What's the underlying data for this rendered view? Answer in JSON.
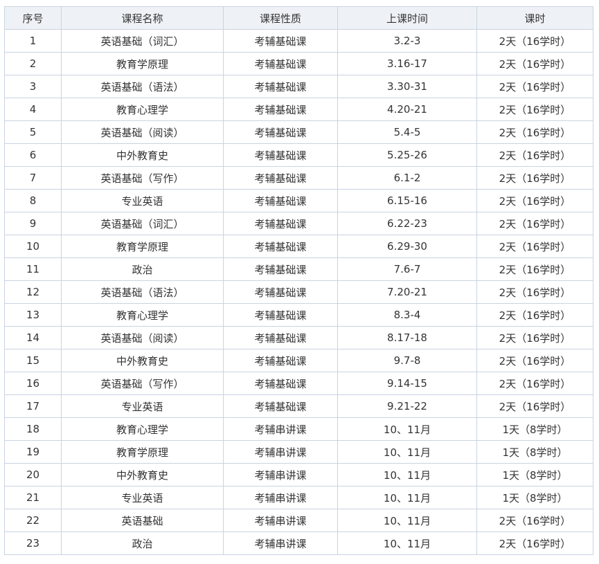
{
  "table": {
    "headers": [
      "序号",
      "课程名称",
      "课程性质",
      "上课时间",
      "课时"
    ],
    "rows": [
      [
        "1",
        "英语基础（词汇）",
        "考辅基础课",
        "3.2-3",
        "2天（16学时）"
      ],
      [
        "2",
        "教育学原理",
        "考辅基础课",
        "3.16-17",
        "2天（16学时）"
      ],
      [
        "3",
        "英语基础（语法）",
        "考辅基础课",
        "3.30-31",
        "2天（16学时）"
      ],
      [
        "4",
        "教育心理学",
        "考辅基础课",
        "4.20-21",
        "2天（16学时）"
      ],
      [
        "5",
        "英语基础（阅读）",
        "考辅基础课",
        "5.4-5",
        "2天（16学时）"
      ],
      [
        "6",
        "中外教育史",
        "考辅基础课",
        "5.25-26",
        "2天（16学时）"
      ],
      [
        "7",
        "英语基础（写作）",
        "考辅基础课",
        "6.1-2",
        "2天（16学时）"
      ],
      [
        "8",
        "专业英语",
        "考辅基础课",
        "6.15-16",
        "2天（16学时）"
      ],
      [
        "9",
        "英语基础（词汇）",
        "考辅基础课",
        "6.22-23",
        "2天（16学时）"
      ],
      [
        "10",
        "教育学原理",
        "考辅基础课",
        "6.29-30",
        "2天（16学时）"
      ],
      [
        "11",
        "政治",
        "考辅基础课",
        "7.6-7",
        "2天（16学时）"
      ],
      [
        "12",
        "英语基础（语法）",
        "考辅基础课",
        "7.20-21",
        "2天（16学时）"
      ],
      [
        "13",
        "教育心理学",
        "考辅基础课",
        "8.3-4",
        "2天（16学时）"
      ],
      [
        "14",
        "英语基础（阅读）",
        "考辅基础课",
        "8.17-18",
        "2天（16学时）"
      ],
      [
        "15",
        "中外教育史",
        "考辅基础课",
        "9.7-8",
        "2天（16学时）"
      ],
      [
        "16",
        "英语基础（写作）",
        "考辅基础课",
        "9.14-15",
        "2天（16学时）"
      ],
      [
        "17",
        "专业英语",
        "考辅基础课",
        "9.21-22",
        "2天（16学时）"
      ],
      [
        "18",
        "教育心理学",
        "考辅串讲课",
        "10、11月",
        "1天（8学时）"
      ],
      [
        "19",
        "教育学原理",
        "考辅串讲课",
        "10、11月",
        "1天（8学时）"
      ],
      [
        "20",
        "中外教育史",
        "考辅串讲课",
        "10、11月",
        "1天（8学时）"
      ],
      [
        "21",
        "专业英语",
        "考辅串讲课",
        "10、11月",
        "1天（8学时）"
      ],
      [
        "22",
        "英语基础",
        "考辅串讲课",
        "10、11月",
        "2天（16学时）"
      ],
      [
        "23",
        "政治",
        "考辅串讲课",
        "10、11月",
        "2天（16学时）"
      ]
    ]
  },
  "colors": {
    "header_bg": "#eef2f6",
    "border": "#c9d3e0",
    "text": "#333333"
  }
}
